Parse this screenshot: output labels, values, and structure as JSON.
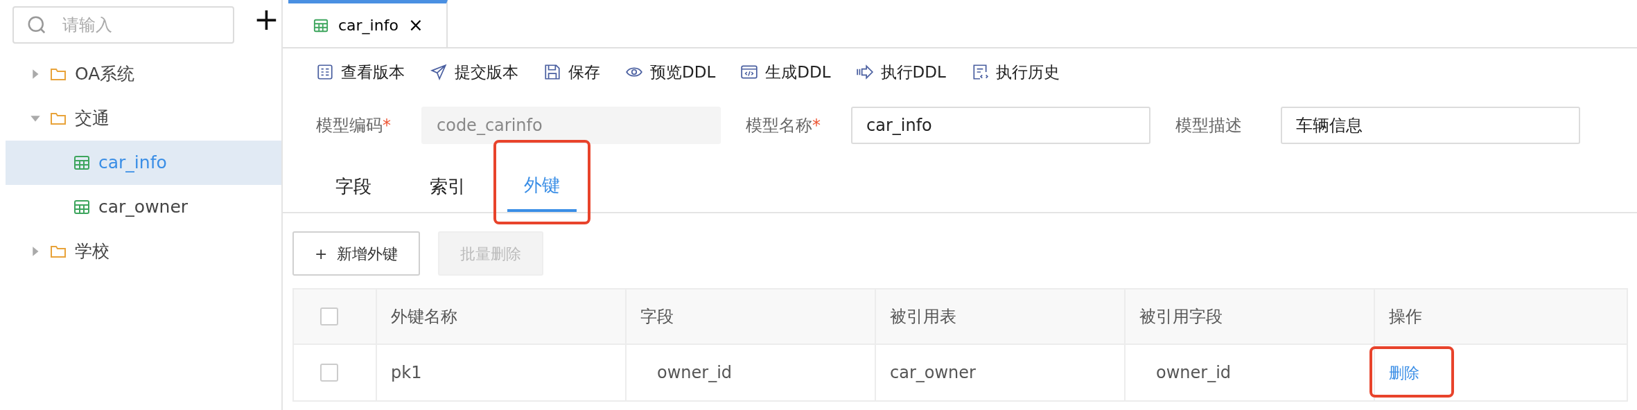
{
  "sidebar": {
    "search": {
      "placeholder": "请输入"
    },
    "add_button": "+",
    "tree": [
      {
        "label": "OA系统",
        "kind": "folder",
        "expanded": false,
        "selected": false
      },
      {
        "label": "交通",
        "kind": "folder",
        "expanded": true,
        "selected": false,
        "children": [
          {
            "label": "car_info",
            "kind": "table",
            "selected": true
          },
          {
            "label": "car_owner",
            "kind": "table",
            "selected": false
          }
        ]
      },
      {
        "label": "学校",
        "kind": "folder",
        "expanded": false,
        "selected": false
      }
    ]
  },
  "editor_tabs": [
    {
      "label": "car_info",
      "close": "×",
      "selected": true
    }
  ],
  "toolbar": [
    {
      "label": "查看版本",
      "kind": "list"
    },
    {
      "label": "提交版本",
      "kind": "send"
    },
    {
      "label": "保存",
      "kind": "save"
    },
    {
      "label": "预览DDL",
      "kind": "eye"
    },
    {
      "label": "生成DDL",
      "kind": "code"
    },
    {
      "label": "执行DDL",
      "kind": "run"
    },
    {
      "label": "执行历史",
      "kind": "history"
    }
  ],
  "form": [
    {
      "label": "模型编码",
      "required_mark": "*",
      "value": "code_carinfo",
      "disabled": true
    },
    {
      "label": "模型名称",
      "required_mark": "*",
      "value": "car_info",
      "disabled": false
    },
    {
      "label": "模型描述",
      "value": "车辆信息",
      "disabled": false
    }
  ],
  "tabs": [
    {
      "label": "字段",
      "selected": false,
      "highlighted": false
    },
    {
      "label": "索引",
      "selected": false,
      "highlighted": false
    },
    {
      "label": "外键",
      "selected": true,
      "highlighted": true
    }
  ],
  "actions": [
    {
      "label": "新增外键",
      "icon": "+",
      "disabled": false
    },
    {
      "label": "批量删除",
      "disabled": true
    }
  ],
  "table": {
    "header_checked": false,
    "columns": [
      "外键名称",
      "字段",
      "被引用表",
      "被引用字段",
      "操作"
    ],
    "rows": [
      {
        "checked": false,
        "cells": [
          "pk1",
          "owner_id",
          "car_owner",
          "owner_id"
        ],
        "action": "删除",
        "highlighted": true
      }
    ]
  }
}
